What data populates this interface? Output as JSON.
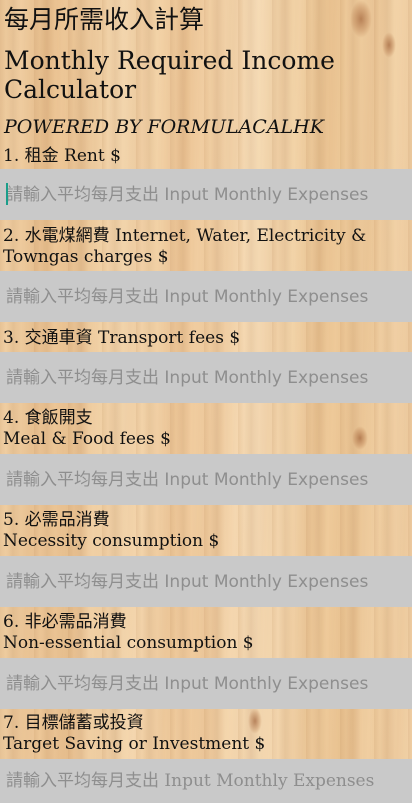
{
  "header": {
    "title": "每月所需收入計算",
    "subtitle": "Monthly Required Income Calculator",
    "powered_by": "POWERED BY FORMULACALHK"
  },
  "fields": [
    {
      "label": "1. 租金 Rent $",
      "value": "",
      "placeholder": "請輸入平均每月支出 Input Monthly Expenses"
    },
    {
      "label": "2. 水電煤網費 Internet, Water, Electricity & Towngas charges $",
      "value": "",
      "placeholder": "請輸入平均每月支出 Input Monthly Expenses"
    },
    {
      "label": "3. 交通車資 Transport fees $",
      "value": "",
      "placeholder": "請輸入平均每月支出 Input Monthly Expenses"
    },
    {
      "label_line1": "4. 食飯開支",
      "label_line2": "Meal & Food fees $",
      "value": "",
      "placeholder": "請輸入平均每月支出 Input Monthly Expenses"
    },
    {
      "label_line1": "5. 必需品消費",
      "label_line2": "Necessity consumption $",
      "value": "",
      "placeholder": "請輸入平均每月支出 Input Monthly Expenses"
    },
    {
      "label_line1": "6. 非必需品消費",
      "label_line2": "Non-essential consumption $",
      "value": "",
      "placeholder": "請輸入平均每月支出 Input Monthly Expenses"
    },
    {
      "label_line1": "7. 目標儲蓄或投資",
      "label_line2": "Target Saving or Investment $",
      "value": "",
      "placeholder": "請輸入平均每月支出 Input Monthly Expenses"
    }
  ]
}
